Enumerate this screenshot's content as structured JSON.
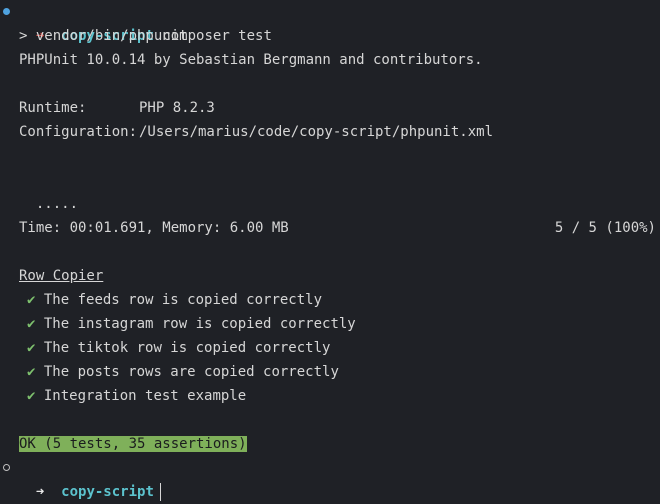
{
  "prompt1": {
    "arrow": "➜",
    "cwd": "copy-script",
    "command": "composer test"
  },
  "output": {
    "run_line": "> vendor/bin/phpunit",
    "version_line": "PHPUnit 10.0.14 by Sebastian Bergmann and contributors.",
    "runtime_label": "Runtime:",
    "runtime_value": "PHP 8.2.3",
    "config_label": "Configuration:",
    "config_value": "/Users/marius/code/copy-script/phpunit.xml",
    "progress_dots": ".....",
    "progress_count": "5 / 5 (100%)",
    "time_memory": "Time: 00:01.691, Memory: 6.00 MB",
    "suite_name": "Row Copier",
    "check_mark": "✔",
    "tests": [
      "The feeds row is copied correctly",
      "The instagram row is copied correctly",
      "The tiktok row is copied correctly",
      "The posts rows are copied correctly",
      "Integration test example"
    ],
    "result": "OK (5 tests, 35 assertions)"
  },
  "prompt2": {
    "arrow": "➜",
    "cwd": "copy-script"
  },
  "colors": {
    "background": "#1f2126",
    "cwd": "#5cc3ce",
    "error_arrow": "#e2584f",
    "check": "#7ec16e",
    "ok_bar": "#7fb05a"
  }
}
